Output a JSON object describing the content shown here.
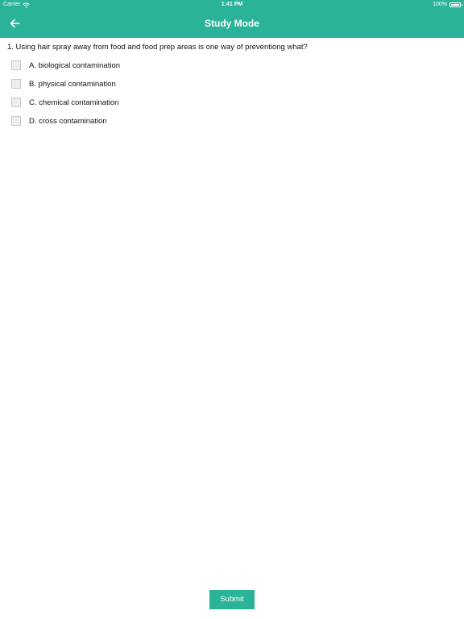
{
  "status_bar": {
    "carrier": "Carrier",
    "time": "1:41 PM",
    "battery": "100%",
    "wifi_icon": "wifi-icon",
    "battery_icon": "battery-icon"
  },
  "nav": {
    "title": "Study Mode",
    "back_icon": "arrow-left-icon"
  },
  "question": {
    "text": "1. Using hair spray away from food and food prep areas is one way of preventiong what?",
    "options": [
      {
        "label": "A. biological contamination",
        "checked": false
      },
      {
        "label": "B. physical contamination",
        "checked": false
      },
      {
        "label": "C. chemical contamination",
        "checked": false
      },
      {
        "label": "D. cross contamination",
        "checked": false
      }
    ]
  },
  "submit_label": "Submit",
  "colors": {
    "accent": "#2bb398",
    "checkbox_bg": "#eeeeee",
    "checkbox_border": "#c8c8c8",
    "text": "#111111"
  }
}
